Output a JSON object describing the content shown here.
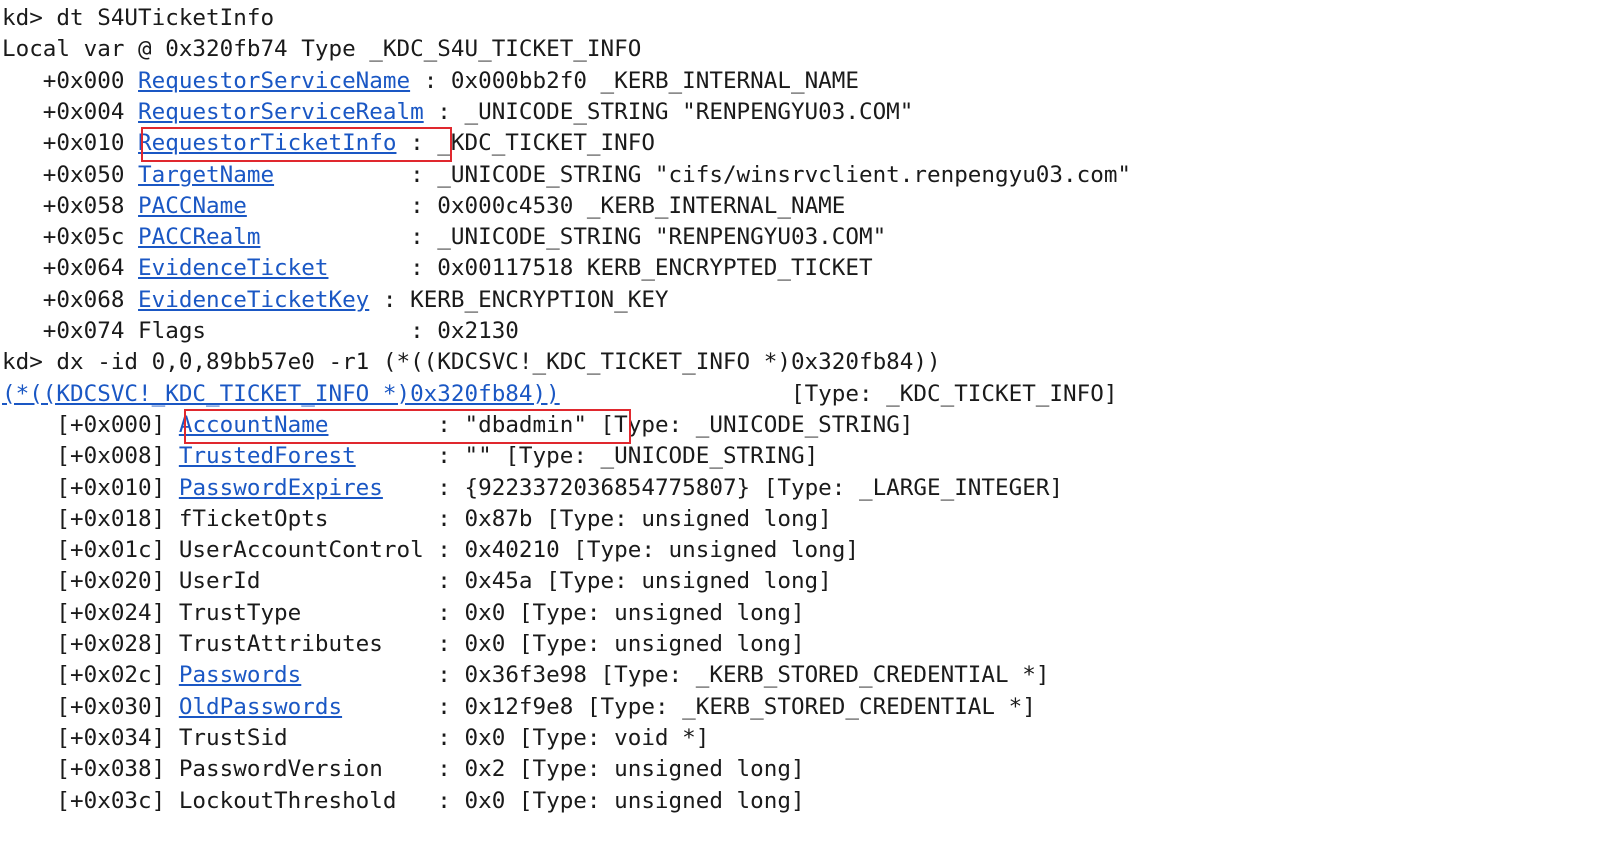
{
  "lines": [
    [
      {
        "t": "kd> dt S4UTicketInfo",
        "link": false
      }
    ],
    [
      {
        "t": "Local var @ 0x320fb74 Type _KDC_S4U_TICKET_INFO",
        "link": false
      }
    ],
    [
      {
        "t": "   +0x000 ",
        "link": false
      },
      {
        "t": "RequestorServiceName",
        "link": true
      },
      {
        "t": " : 0x000bb2f0 _KERB_INTERNAL_NAME",
        "link": false
      }
    ],
    [
      {
        "t": "   +0x004 ",
        "link": false
      },
      {
        "t": "RequestorServiceRealm",
        "link": true
      },
      {
        "t": " : _UNICODE_STRING \"RENPENGYU03.COM\"",
        "link": false
      }
    ],
    [
      {
        "t": "   +0x010 ",
        "link": false
      },
      {
        "t": "RequestorTicketInfo",
        "link": true
      },
      {
        "t": " : _KDC_TICKET_INFO",
        "link": false
      }
    ],
    [
      {
        "t": "   +0x050 ",
        "link": false
      },
      {
        "t": "TargetName",
        "link": true
      },
      {
        "t": "          : _UNICODE_STRING \"cifs/winsrvclient.renpengyu03.com\"",
        "link": false
      }
    ],
    [
      {
        "t": "   +0x058 ",
        "link": false
      },
      {
        "t": "PACCName",
        "link": true
      },
      {
        "t": "            : 0x000c4530 _KERB_INTERNAL_NAME",
        "link": false
      }
    ],
    [
      {
        "t": "   +0x05c ",
        "link": false
      },
      {
        "t": "PACCRealm",
        "link": true
      },
      {
        "t": "           : _UNICODE_STRING \"RENPENGYU03.COM\"",
        "link": false
      }
    ],
    [
      {
        "t": "   +0x064 ",
        "link": false
      },
      {
        "t": "EvidenceTicket",
        "link": true
      },
      {
        "t": "      : 0x00117518 KERB_ENCRYPTED_TICKET",
        "link": false
      }
    ],
    [
      {
        "t": "   +0x068 ",
        "link": false
      },
      {
        "t": "EvidenceTicketKey",
        "link": true
      },
      {
        "t": " : KERB_ENCRYPTION_KEY",
        "link": false
      }
    ],
    [
      {
        "t": "   +0x074 Flags               : 0x2130",
        "link": false
      }
    ],
    [
      {
        "t": "kd> dx -id 0,0,89bb57e0 -r1 (*((KDCSVC!_KDC_TICKET_INFO *)0x320fb84))",
        "link": false
      }
    ],
    [
      {
        "t": "(*((KDCSVC!_KDC_TICKET_INFO *)0x320fb84))",
        "link": true
      },
      {
        "t": "                 [Type: _KDC_TICKET_INFO]",
        "link": false
      }
    ],
    [
      {
        "t": "    [+0x000] ",
        "link": false
      },
      {
        "t": "AccountName",
        "link": true
      },
      {
        "t": "        : \"dbadmin\" [Type: _UNICODE_STRING]",
        "link": false
      }
    ],
    [
      {
        "t": "    [+0x008] ",
        "link": false
      },
      {
        "t": "TrustedForest",
        "link": true
      },
      {
        "t": "      : \"\" [Type: _UNICODE_STRING]",
        "link": false
      }
    ],
    [
      {
        "t": "    [+0x010] ",
        "link": false
      },
      {
        "t": "PasswordExpires",
        "link": true
      },
      {
        "t": "    : {9223372036854775807} [Type: _LARGE_INTEGER]",
        "link": false
      }
    ],
    [
      {
        "t": "    [+0x018] fTicketOpts        : 0x87b [Type: unsigned long]",
        "link": false
      }
    ],
    [
      {
        "t": "    [+0x01c] UserAccountControl : 0x40210 [Type: unsigned long]",
        "link": false
      }
    ],
    [
      {
        "t": "    [+0x020] UserId             : 0x45a [Type: unsigned long]",
        "link": false
      }
    ],
    [
      {
        "t": "    [+0x024] TrustType          : 0x0 [Type: unsigned long]",
        "link": false
      }
    ],
    [
      {
        "t": "    [+0x028] TrustAttributes    : 0x0 [Type: unsigned long]",
        "link": false
      }
    ],
    [
      {
        "t": "    [+0x02c] ",
        "link": false
      },
      {
        "t": "Passwords",
        "link": true
      },
      {
        "t": "          : 0x36f3e98 [Type: _KERB_STORED_CREDENTIAL *]",
        "link": false
      }
    ],
    [
      {
        "t": "    [+0x030] ",
        "link": false
      },
      {
        "t": "OldPasswords",
        "link": true
      },
      {
        "t": "       : 0x12f9e8 [Type: _KERB_STORED_CREDENTIAL *]",
        "link": false
      }
    ],
    [
      {
        "t": "    [+0x034] TrustSid           : 0x0 [Type: void *]",
        "link": false
      }
    ],
    [
      {
        "t": "    [+0x038] PasswordVersion    : 0x2 [Type: unsigned long]",
        "link": false
      }
    ],
    [
      {
        "t": "    [+0x03c] LockoutThreshold   : 0x0 [Type: unsigned long]",
        "link": false
      }
    ]
  ],
  "highlights": [
    "RequestorTicketInfo",
    "AccountName : \"dbadmin\""
  ],
  "colors": {
    "link": "#1a57c4",
    "text": "#1a1a1a",
    "highlight": "#e0282e",
    "background": "#ffffff"
  }
}
